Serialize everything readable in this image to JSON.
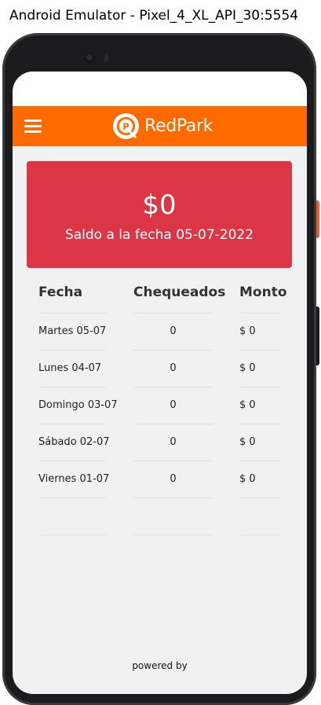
{
  "window": {
    "title": "Android Emulator - Pixel_4_XL_API_30:5554"
  },
  "header": {
    "brand": "RedPark",
    "menu_icon": "hamburger-menu-icon",
    "logo_icon": "redpark-logo-icon"
  },
  "colors": {
    "appbar": "#ff6a00",
    "balance_card": "#dc3545",
    "background": "#f1f1f1"
  },
  "balance": {
    "amount": "$0",
    "caption": "Saldo a la fecha 05-07-2022"
  },
  "table": {
    "headers": {
      "fecha": "Fecha",
      "chequeados": "Chequeados",
      "monto": "Monto"
    },
    "rows": [
      {
        "fecha": "Martes 05-07",
        "chequeados": "0",
        "monto": "$ 0"
      },
      {
        "fecha": "Lunes 04-07",
        "chequeados": "0",
        "monto": "$ 0"
      },
      {
        "fecha": "Domingo 03-07",
        "chequeados": "0",
        "monto": "$ 0"
      },
      {
        "fecha": "Sábado 02-07",
        "chequeados": "0",
        "monto": "$ 0"
      },
      {
        "fecha": "Viernes 01-07",
        "chequeados": "0",
        "monto": "$ 0"
      },
      {
        "fecha": "",
        "chequeados": "",
        "monto": ""
      }
    ]
  },
  "footer": {
    "text": "powered by"
  }
}
